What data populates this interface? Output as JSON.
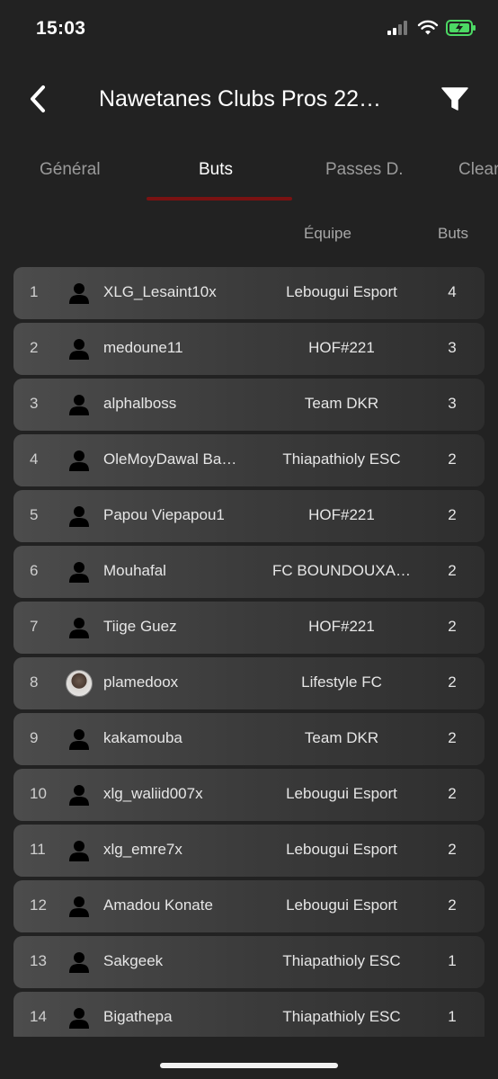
{
  "status_bar": {
    "time": "15:03"
  },
  "nav": {
    "title": "Nawetanes Clubs Pros 22…"
  },
  "tabs": [
    {
      "label": "Général",
      "active": false
    },
    {
      "label": "Buts",
      "active": true
    },
    {
      "label": "Passes D.",
      "active": false
    },
    {
      "label": "Clear",
      "active": false
    }
  ],
  "columns": {
    "team": "Équipe",
    "goals": "Buts"
  },
  "rows": [
    {
      "rank": "1",
      "player": "XLG_Lesaint10x",
      "team": "Lebougui Esport",
      "goals": "4",
      "avatar": "person-icon"
    },
    {
      "rank": "2",
      "player": "medoune11",
      "team": "HOF#221",
      "goals": "3",
      "avatar": "person-icon"
    },
    {
      "rank": "3",
      "player": "alphalboss",
      "team": "Team DKR",
      "goals": "3",
      "avatar": "person-icon"
    },
    {
      "rank": "4",
      "player": "OleMoyDawal Ba…",
      "team": "Thiapathioly ESC",
      "goals": "2",
      "avatar": "person-icon"
    },
    {
      "rank": "5",
      "player": "Papou Viepapou1",
      "team": "HOF#221",
      "goals": "2",
      "avatar": "person-icon"
    },
    {
      "rank": "6",
      "player": "Mouhafal",
      "team": "FC BOUNDOUXA…",
      "goals": "2",
      "avatar": "person-icon"
    },
    {
      "rank": "7",
      "player": "Tiige Guez",
      "team": "HOF#221",
      "goals": "2",
      "avatar": "person-icon"
    },
    {
      "rank": "8",
      "player": "plamedoox",
      "team": "Lifestyle FC",
      "goals": "2",
      "avatar": "photo"
    },
    {
      "rank": "9",
      "player": "kakamouba",
      "team": "Team DKR",
      "goals": "2",
      "avatar": "person-icon"
    },
    {
      "rank": "10",
      "player": "xlg_waliid007x",
      "team": "Lebougui Esport",
      "goals": "2",
      "avatar": "person-icon"
    },
    {
      "rank": "11",
      "player": "xlg_emre7x",
      "team": "Lebougui Esport",
      "goals": "2",
      "avatar": "person-icon"
    },
    {
      "rank": "12",
      "player": "Amadou Konate",
      "team": "Lebougui Esport",
      "goals": "2",
      "avatar": "person-icon"
    },
    {
      "rank": "13",
      "player": "Sakgeek",
      "team": "Thiapathioly ESC",
      "goals": "1",
      "avatar": "person-icon"
    },
    {
      "rank": "14",
      "player": "Bigathepa",
      "team": "Thiapathioly ESC",
      "goals": "1",
      "avatar": "person-icon"
    }
  ],
  "colors": {
    "background": "#222222",
    "tab_underline": "#7a1212",
    "battery": "#4cd964"
  }
}
